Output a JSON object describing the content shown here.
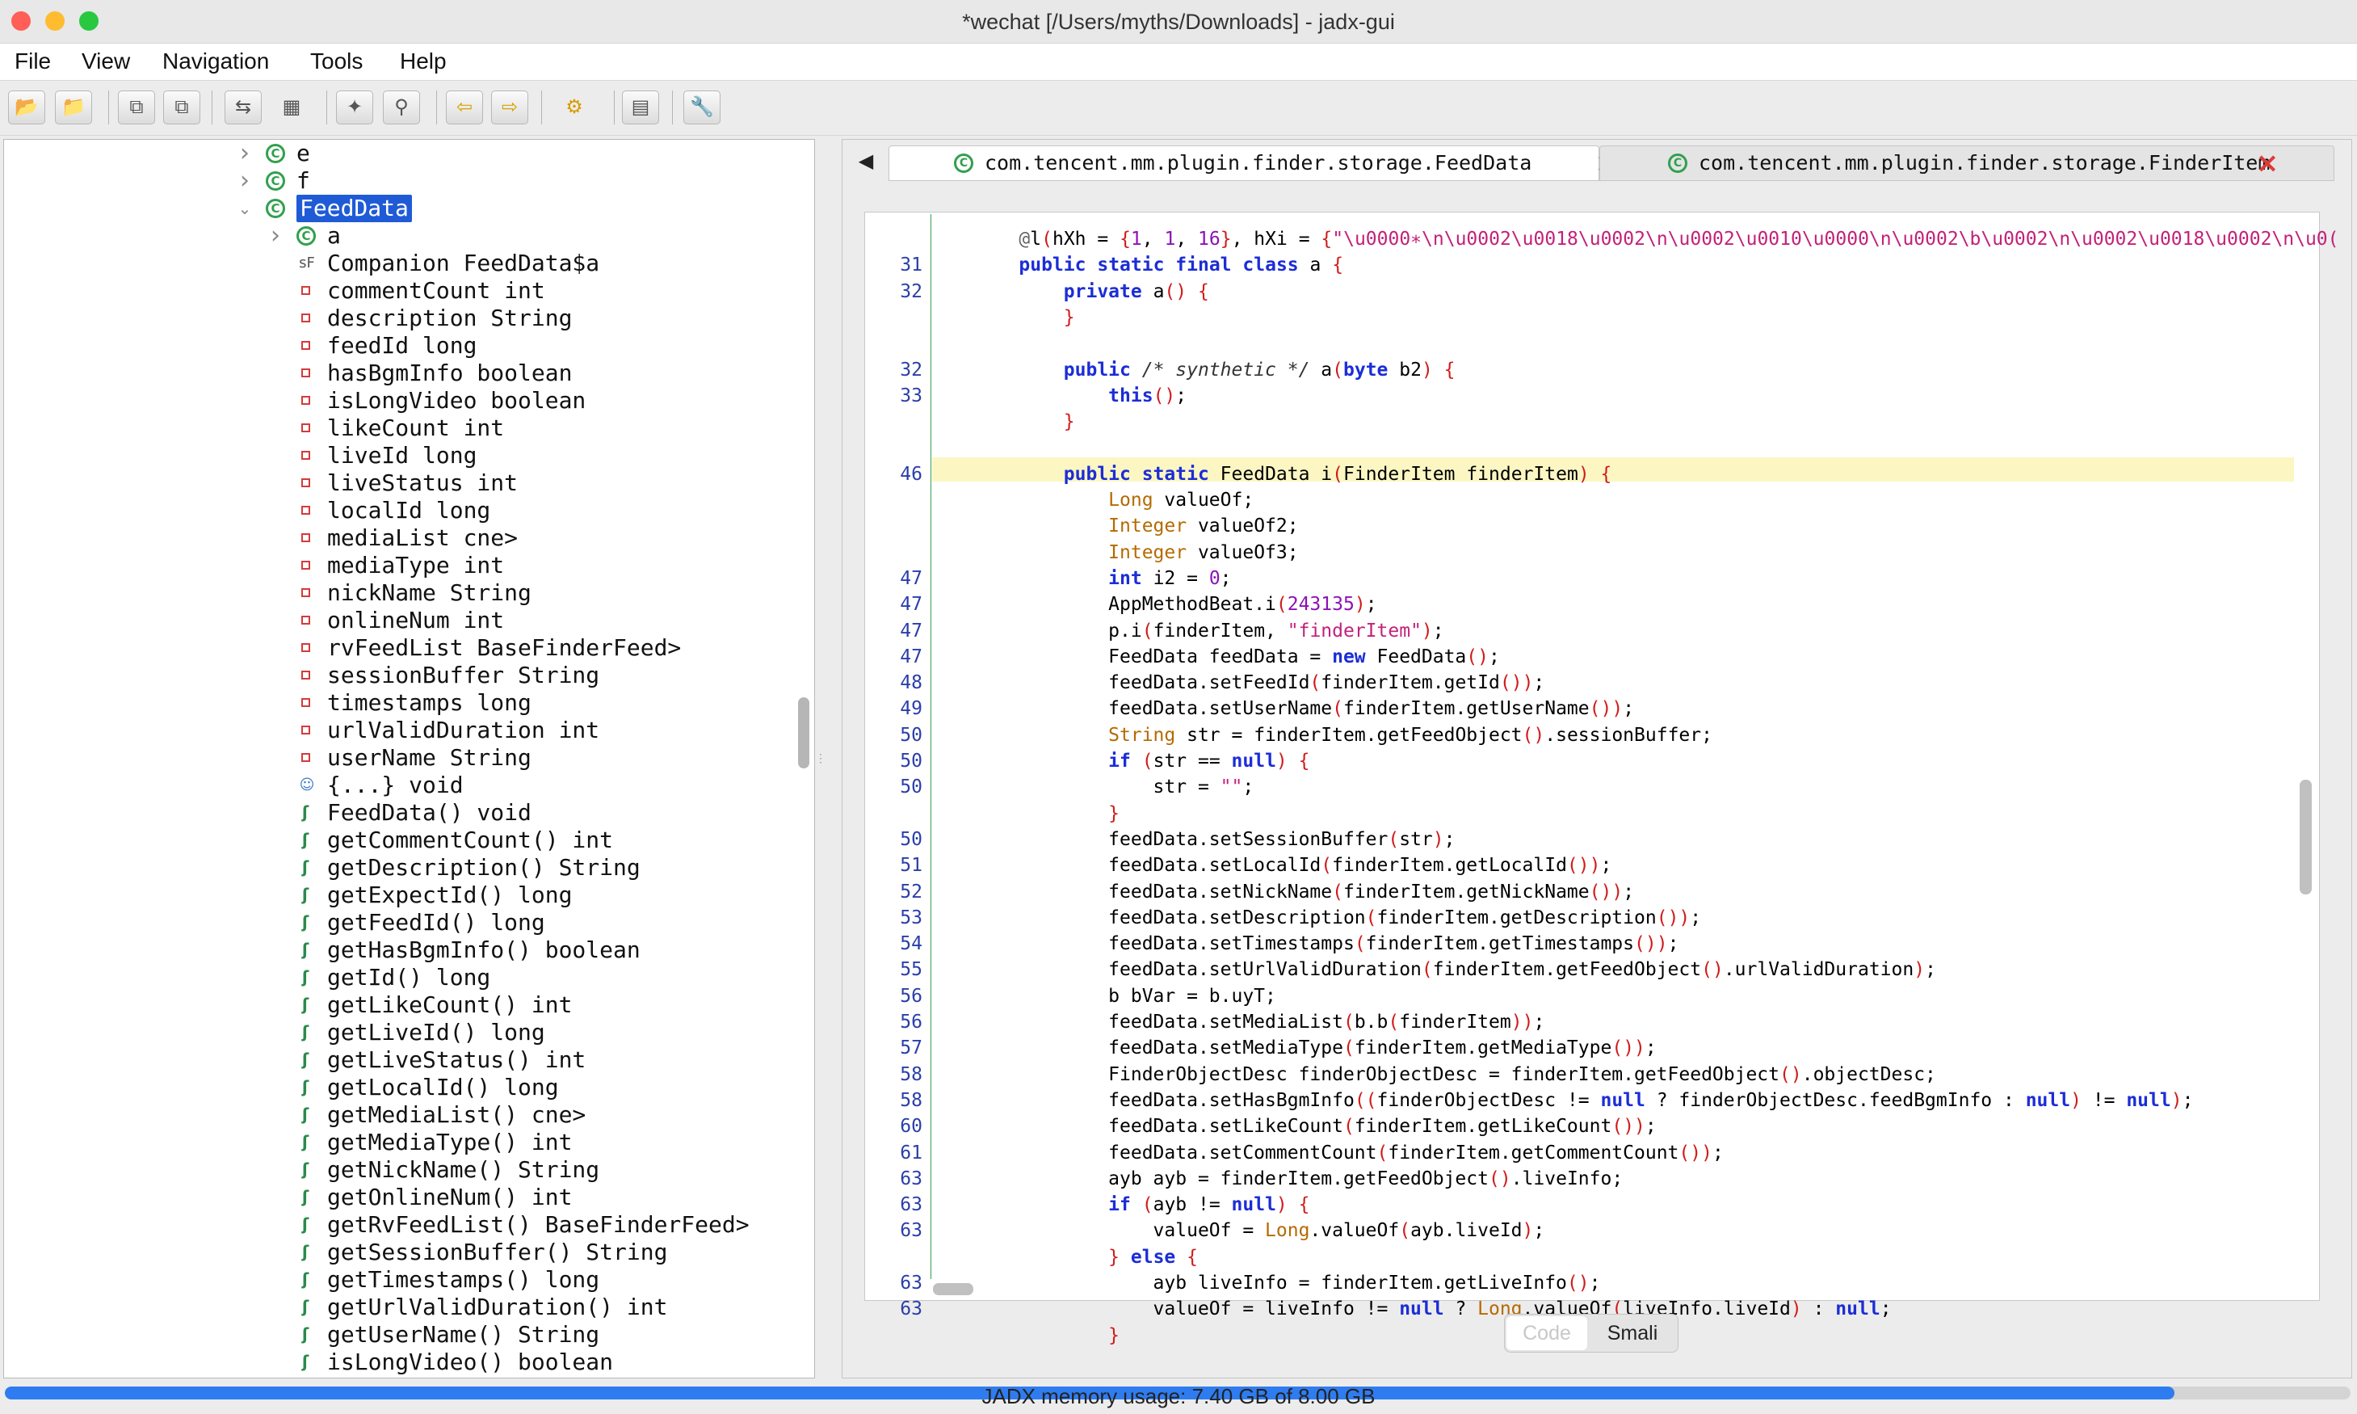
{
  "window": {
    "title": "*wechat [/Users/myths/Downloads] - jadx-gui"
  },
  "menu": {
    "file": "File",
    "view": "View",
    "navigation": "Navigation",
    "tools": "Tools",
    "help": "Help"
  },
  "toolbar": {
    "icons": [
      "open-file-icon",
      "add-files-icon",
      "save-all-icon",
      "export-icon",
      "sync-icon",
      "flatten-packages-icon",
      "search-text-icon",
      "find-class-icon",
      "back-icon",
      "forward-icon",
      "deobfuscation-icon",
      "log-viewer-icon",
      "preferences-icon"
    ]
  },
  "tree": {
    "rows": [
      {
        "label": "e",
        "kind": "class",
        "expander": "right"
      },
      {
        "label": "f",
        "kind": "class",
        "expander": "right"
      },
      {
        "label": "FeedData",
        "kind": "class",
        "expander": "down",
        "selected": true
      },
      {
        "label": "a",
        "kind": "class",
        "expander": "right"
      },
      {
        "label": "Companion FeedData$a",
        "kind": "companion"
      },
      {
        "label": "commentCount int",
        "kind": "field"
      },
      {
        "label": "description String",
        "kind": "field"
      },
      {
        "label": "feedId long",
        "kind": "field"
      },
      {
        "label": "hasBgmInfo boolean",
        "kind": "field"
      },
      {
        "label": "isLongVideo boolean",
        "kind": "field"
      },
      {
        "label": "likeCount int",
        "kind": "field"
      },
      {
        "label": "liveId long",
        "kind": "field"
      },
      {
        "label": "liveStatus int",
        "kind": "field"
      },
      {
        "label": "localId long",
        "kind": "field"
      },
      {
        "label": "mediaList cne>",
        "kind": "field"
      },
      {
        "label": "mediaType int",
        "kind": "field"
      },
      {
        "label": "nickName String",
        "kind": "field"
      },
      {
        "label": "onlineNum int",
        "kind": "field"
      },
      {
        "label": "rvFeedList BaseFinderFeed>",
        "kind": "field"
      },
      {
        "label": "sessionBuffer String",
        "kind": "field"
      },
      {
        "label": "timestamps long",
        "kind": "field"
      },
      {
        "label": "urlValidDuration int",
        "kind": "field"
      },
      {
        "label": "userName String",
        "kind": "field"
      },
      {
        "label": "{...} void",
        "kind": "init"
      },
      {
        "label": "FeedData() void",
        "kind": "method"
      },
      {
        "label": "getCommentCount() int",
        "kind": "method"
      },
      {
        "label": "getDescription() String",
        "kind": "method"
      },
      {
        "label": "getExpectId() long",
        "kind": "method"
      },
      {
        "label": "getFeedId() long",
        "kind": "method"
      },
      {
        "label": "getHasBgmInfo() boolean",
        "kind": "method"
      },
      {
        "label": "getId() long",
        "kind": "method"
      },
      {
        "label": "getLikeCount() int",
        "kind": "method"
      },
      {
        "label": "getLiveId() long",
        "kind": "method"
      },
      {
        "label": "getLiveStatus() int",
        "kind": "method"
      },
      {
        "label": "getLocalId() long",
        "kind": "method"
      },
      {
        "label": "getMediaList() cne>",
        "kind": "method"
      },
      {
        "label": "getMediaType() int",
        "kind": "method"
      },
      {
        "label": "getNickName() String",
        "kind": "method"
      },
      {
        "label": "getOnlineNum() int",
        "kind": "method"
      },
      {
        "label": "getRvFeedList() BaseFinderFeed>",
        "kind": "method"
      },
      {
        "label": "getSessionBuffer() String",
        "kind": "method"
      },
      {
        "label": "getTimestamps() long",
        "kind": "method"
      },
      {
        "label": "getUrlValidDuration() int",
        "kind": "method"
      },
      {
        "label": "getUserName() String",
        "kind": "method"
      },
      {
        "label": "isLongVideo() boolean",
        "kind": "method"
      }
    ]
  },
  "tabs": [
    {
      "label": "com.tencent.mm.plugin.finder.storage.FeedData",
      "active": true
    },
    {
      "label": "com.tencent.mm.plugin.finder.storage.FinderItem",
      "active": false
    }
  ],
  "code": {
    "lines": [
      {
        "n": "",
        "t": "    @l(hXh = {1, 1, 16}, hXi = {\"\\u0000∗\\n\\u0002\\u0018\\u0002\\n\\u0002\\u0010\\u0000\\n\\u0002\\b\\u0002\\n\\u0002\\u0018\\u0002\\n\\u0("
      },
      {
        "n": "31",
        "t": "    public static final class a {"
      },
      {
        "n": "32",
        "t": "        private a() {"
      },
      {
        "n": "",
        "t": "        }"
      },
      {
        "n": "",
        "t": ""
      },
      {
        "n": "32",
        "t": "        public /* synthetic */ a(byte b2) {"
      },
      {
        "n": "33",
        "t": "            this();"
      },
      {
        "n": "",
        "t": "        }"
      },
      {
        "n": "",
        "t": ""
      },
      {
        "n": "46",
        "t": "        public static FeedData i(FinderItem finderItem) {"
      },
      {
        "n": "",
        "t": "            Long valueOf;"
      },
      {
        "n": "",
        "t": "            Integer valueOf2;"
      },
      {
        "n": "",
        "t": "            Integer valueOf3;"
      },
      {
        "n": "47",
        "t": "            int i2 = 0;"
      },
      {
        "n": "47",
        "t": "            AppMethodBeat.i(243135);"
      },
      {
        "n": "47",
        "t": "            p.i(finderItem, \"finderItem\");"
      },
      {
        "n": "47",
        "t": "            FeedData feedData = new FeedData();"
      },
      {
        "n": "48",
        "t": "            feedData.setFeedId(finderItem.getId());"
      },
      {
        "n": "49",
        "t": "            feedData.setUserName(finderItem.getUserName());"
      },
      {
        "n": "50",
        "t": "            String str = finderItem.getFeedObject().sessionBuffer;"
      },
      {
        "n": "50",
        "t": "            if (str == null) {"
      },
      {
        "n": "50",
        "t": "                str = \"\";"
      },
      {
        "n": "",
        "t": "            }"
      },
      {
        "n": "50",
        "t": "            feedData.setSessionBuffer(str);"
      },
      {
        "n": "51",
        "t": "            feedData.setLocalId(finderItem.getLocalId());"
      },
      {
        "n": "52",
        "t": "            feedData.setNickName(finderItem.getNickName());"
      },
      {
        "n": "53",
        "t": "            feedData.setDescription(finderItem.getDescription());"
      },
      {
        "n": "54",
        "t": "            feedData.setTimestamps(finderItem.getTimestamps());"
      },
      {
        "n": "55",
        "t": "            feedData.setUrlValidDuration(finderItem.getFeedObject().urlValidDuration);"
      },
      {
        "n": "56",
        "t": "            b bVar = b.uyT;"
      },
      {
        "n": "56",
        "t": "            feedData.setMediaList(b.b(finderItem));"
      },
      {
        "n": "57",
        "t": "            feedData.setMediaType(finderItem.getMediaType());"
      },
      {
        "n": "58",
        "t": "            FinderObjectDesc finderObjectDesc = finderItem.getFeedObject().objectDesc;"
      },
      {
        "n": "58",
        "t": "            feedData.setHasBgmInfo((finderObjectDesc != null ? finderObjectDesc.feedBgmInfo : null) != null);"
      },
      {
        "n": "60",
        "t": "            feedData.setLikeCount(finderItem.getLikeCount());"
      },
      {
        "n": "61",
        "t": "            feedData.setCommentCount(finderItem.getCommentCount());"
      },
      {
        "n": "63",
        "t": "            ayb ayb = finderItem.getFeedObject().liveInfo;"
      },
      {
        "n": "63",
        "t": "            if (ayb != null) {"
      },
      {
        "n": "63",
        "t": "                valueOf = Long.valueOf(ayb.liveId);"
      },
      {
        "n": "",
        "t": "            } else {"
      },
      {
        "n": "63",
        "t": "                ayb liveInfo = finderItem.getLiveInfo();"
      },
      {
        "n": "63",
        "t": "                valueOf = liveInfo != null ? Long.valueOf(liveInfo.liveId) : null;"
      },
      {
        "n": "",
        "t": "            }"
      }
    ]
  },
  "view_switch": {
    "code": "Code",
    "smali": "Smali"
  },
  "status": {
    "memory_text": "JADX memory usage: 7.40 GB of 8.00 GB",
    "memory_used_fraction": 0.925
  },
  "colors": {
    "close": "#ff5f57",
    "minimize": "#febc2e",
    "zoom": "#28c840",
    "selection": "#1f5bd6",
    "accent": "#2f7cf0"
  }
}
